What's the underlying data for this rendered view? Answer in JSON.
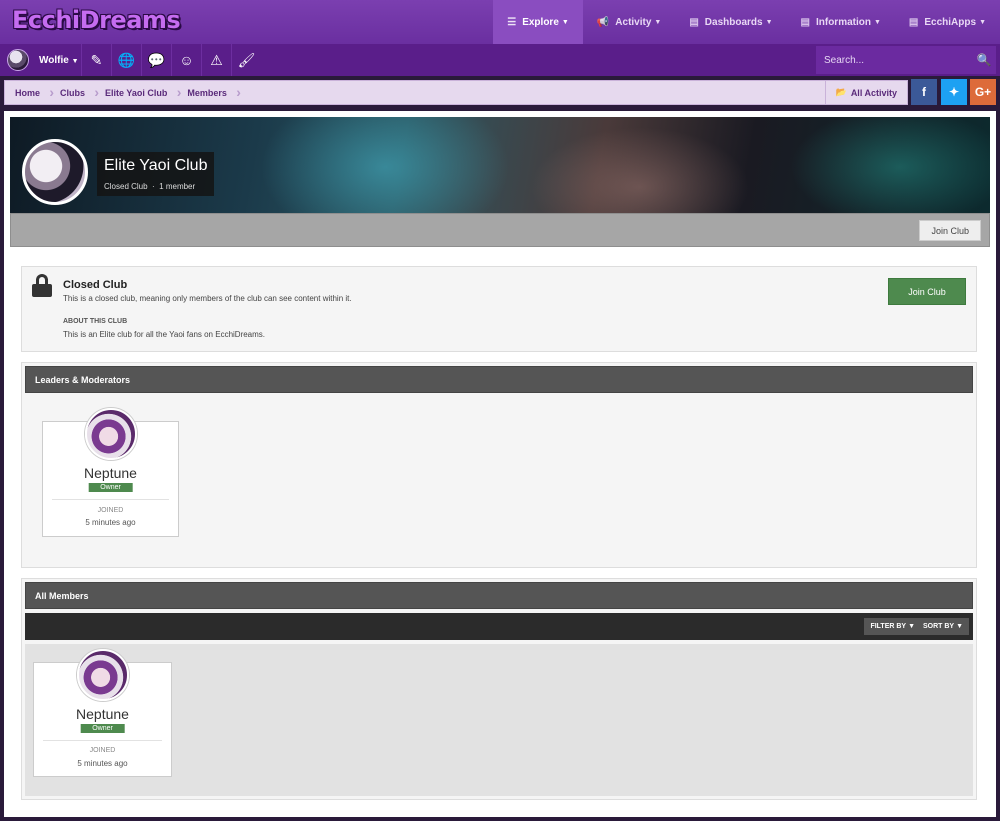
{
  "site": {
    "logo_text": "EcchiDreams"
  },
  "topnav": [
    {
      "label": "Explore",
      "icon": "list-icon",
      "active": true
    },
    {
      "label": "Activity",
      "icon": "megaphone-icon"
    },
    {
      "label": "Dashboards",
      "icon": "document-icon"
    },
    {
      "label": "Information",
      "icon": "document-icon"
    },
    {
      "label": "EcchiApps",
      "icon": "document-icon"
    }
  ],
  "userbar": {
    "username": "Wolfie",
    "search_placeholder": "Search..."
  },
  "breadcrumb": [
    "Home",
    "Clubs",
    "Elite Yaoi Club",
    "Members"
  ],
  "all_activity": "All Activity",
  "social": {
    "facebook": "f",
    "twitter": "🐦",
    "google": "G+"
  },
  "club": {
    "title": "Elite Yaoi Club",
    "type": "Closed Club",
    "members": "1 member",
    "separator": "·",
    "join_label": "Join Club"
  },
  "info": {
    "heading": "Closed Club",
    "description": "This is a closed club, meaning only members of the club can see content within it.",
    "about_caption": "ABOUT THIS CLUB",
    "about_text": "This is an Elite club for all the Yaoi fans on EcchiDreams.",
    "join_label": "Join Club"
  },
  "leaders": {
    "heading": "Leaders & Moderators",
    "member": {
      "name": "Neptune",
      "role": "Owner",
      "joined_label": "JOINED",
      "joined_time": "5 minutes ago"
    }
  },
  "all_members": {
    "heading": "All Members",
    "filter_label": "FILTER BY",
    "sort_label": "SORT BY",
    "member": {
      "name": "Neptune",
      "role": "Owner",
      "joined_label": "JOINED",
      "joined_time": "5 minutes ago"
    }
  },
  "colors": {
    "purple": "#6a2fa0",
    "green": "#4e8a4e",
    "dark_header": "#555555"
  }
}
